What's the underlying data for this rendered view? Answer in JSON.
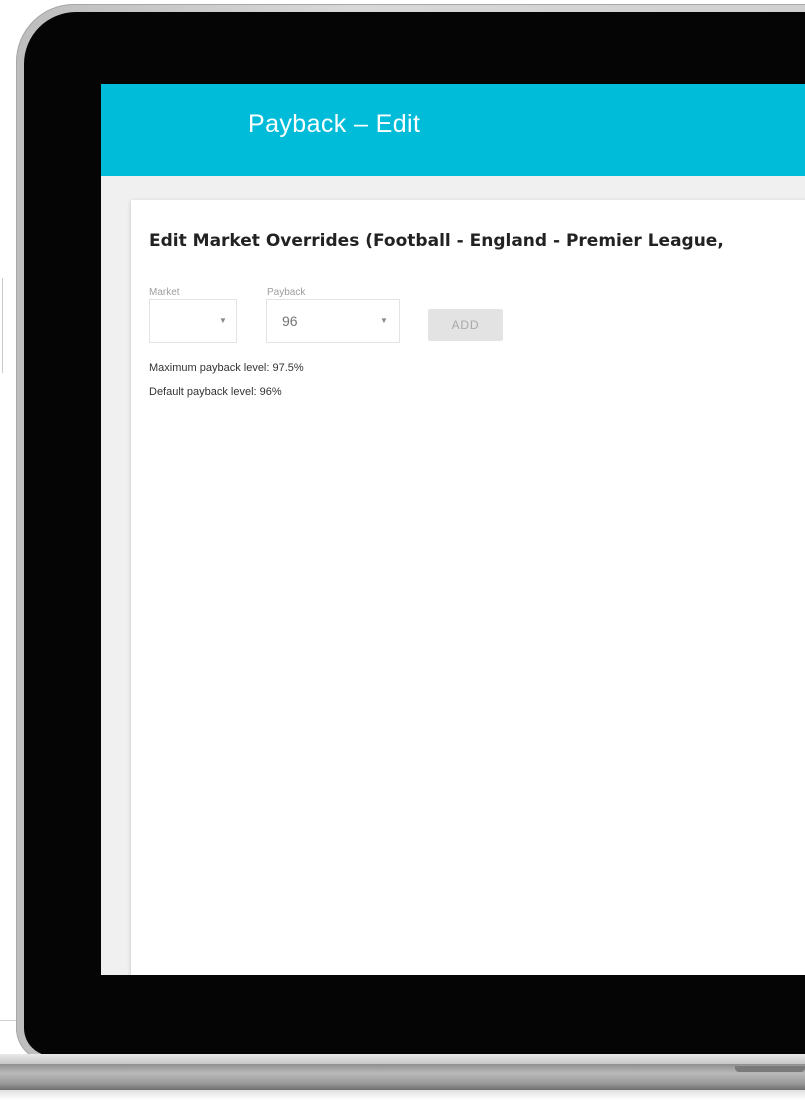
{
  "header": {
    "title": "Payback  – Edit"
  },
  "card": {
    "title": "Edit Market Overrides (Football - England - Premier League,"
  },
  "form": {
    "market": {
      "label": "Market",
      "value": ""
    },
    "payback": {
      "label": "Payback",
      "value": "96"
    },
    "add_button_label": "ADD"
  },
  "info": {
    "max_payback": "Maximum payback level: 97.5%",
    "default_payback": "Default payback level: 96%"
  },
  "icons": {
    "dropdown": "chevron-down-icon"
  },
  "colors": {
    "header_bg": "#00bcd9",
    "header_text": "#ffffff",
    "disabled_button_bg": "#e3e3e3",
    "disabled_button_text": "#a9a9a9"
  }
}
